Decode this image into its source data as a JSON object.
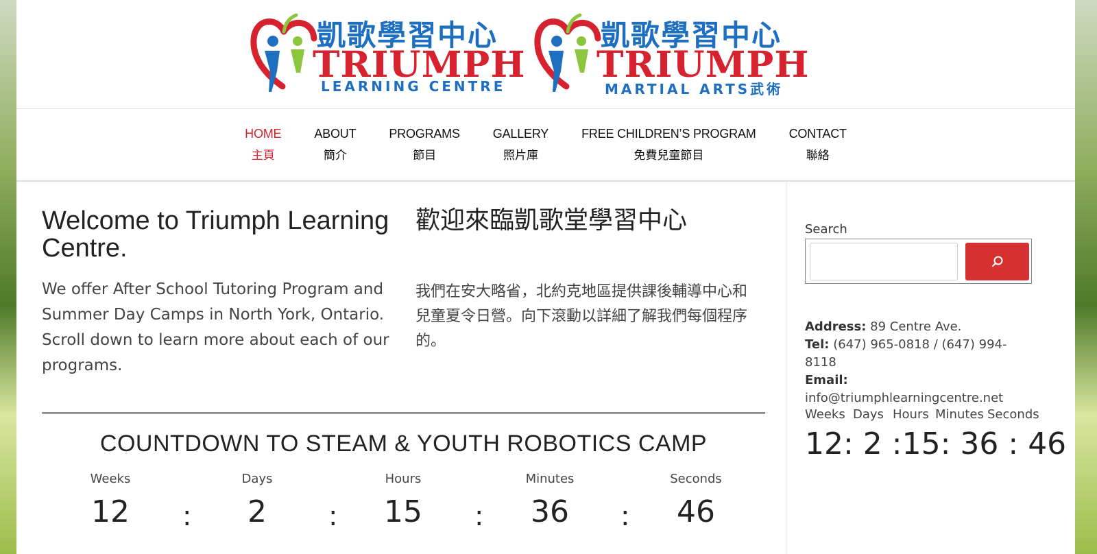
{
  "logos": {
    "learning": {
      "chinese": "凱歌學習中心",
      "name": "TRIUMPH",
      "sub": "LEARNING CENTRE"
    },
    "martial": {
      "chinese": "凱歌學習中心",
      "name": "TRIUMPH",
      "sub": "MARTIAL ARTS武術"
    }
  },
  "nav": {
    "items": [
      {
        "en": "HOME",
        "zh": "主頁",
        "active": true
      },
      {
        "en": "ABOUT",
        "zh": "簡介",
        "active": false
      },
      {
        "en": "PROGRAMS",
        "zh": "節目",
        "active": false
      },
      {
        "en": "GALLERY",
        "zh": "照片庫",
        "active": false
      },
      {
        "en": "FREE CHILDREN’S PROGRAM",
        "zh": "免費兒童節目",
        "active": false
      },
      {
        "en": "CONTACT",
        "zh": "聯絡",
        "active": false
      }
    ]
  },
  "main": {
    "welcome_en": "Welcome to Triumph Learning Centre.",
    "welcome_zh": "歡迎來臨凱歌堂學習中心",
    "intro_en": "We offer After School Tutoring Program and Summer Day Camps in North York, Ontario. Scroll down to learn more about each of our programs.",
    "intro_zh": "我們在安大略省，北約克地區提供課後輔導中心和兒童夏令日營。向下滾動以詳細了解我們每個程序的。",
    "countdown_title": "COUNTDOWN TO STEAM & YOUTH ROBOTICS CAMP",
    "countdown": [
      {
        "label": "Weeks",
        "value": "12"
      },
      {
        "label": "Days",
        "value": "2"
      },
      {
        "label": "Hours",
        "value": "15"
      },
      {
        "label": "Minutes",
        "value": "36"
      },
      {
        "label": "Seconds",
        "value": "46"
      }
    ],
    "separator": ":"
  },
  "sidebar": {
    "search_label": "Search",
    "address_label": "Address:",
    "address_value": "89 Centre Ave.",
    "tel_label": "Tel:",
    "tel_value": "(647) 965-0818 / (647) 994-8118",
    "email_label": "Email:",
    "email_value": "info@triumphlearningcentre.net",
    "countdown_labels": [
      "Weeks",
      "Days",
      "Hours",
      "Minutes",
      "Seconds"
    ],
    "countdown_values": "12: 2 :15: 36 : 46"
  },
  "colors": {
    "accent": "#d6222f",
    "brand_blue": "#1f6fc0",
    "search_button": "#d63031",
    "logo_green": "#8cc63f"
  },
  "icons": {
    "search": "search-icon",
    "logo": "apple-people-logo-icon"
  }
}
